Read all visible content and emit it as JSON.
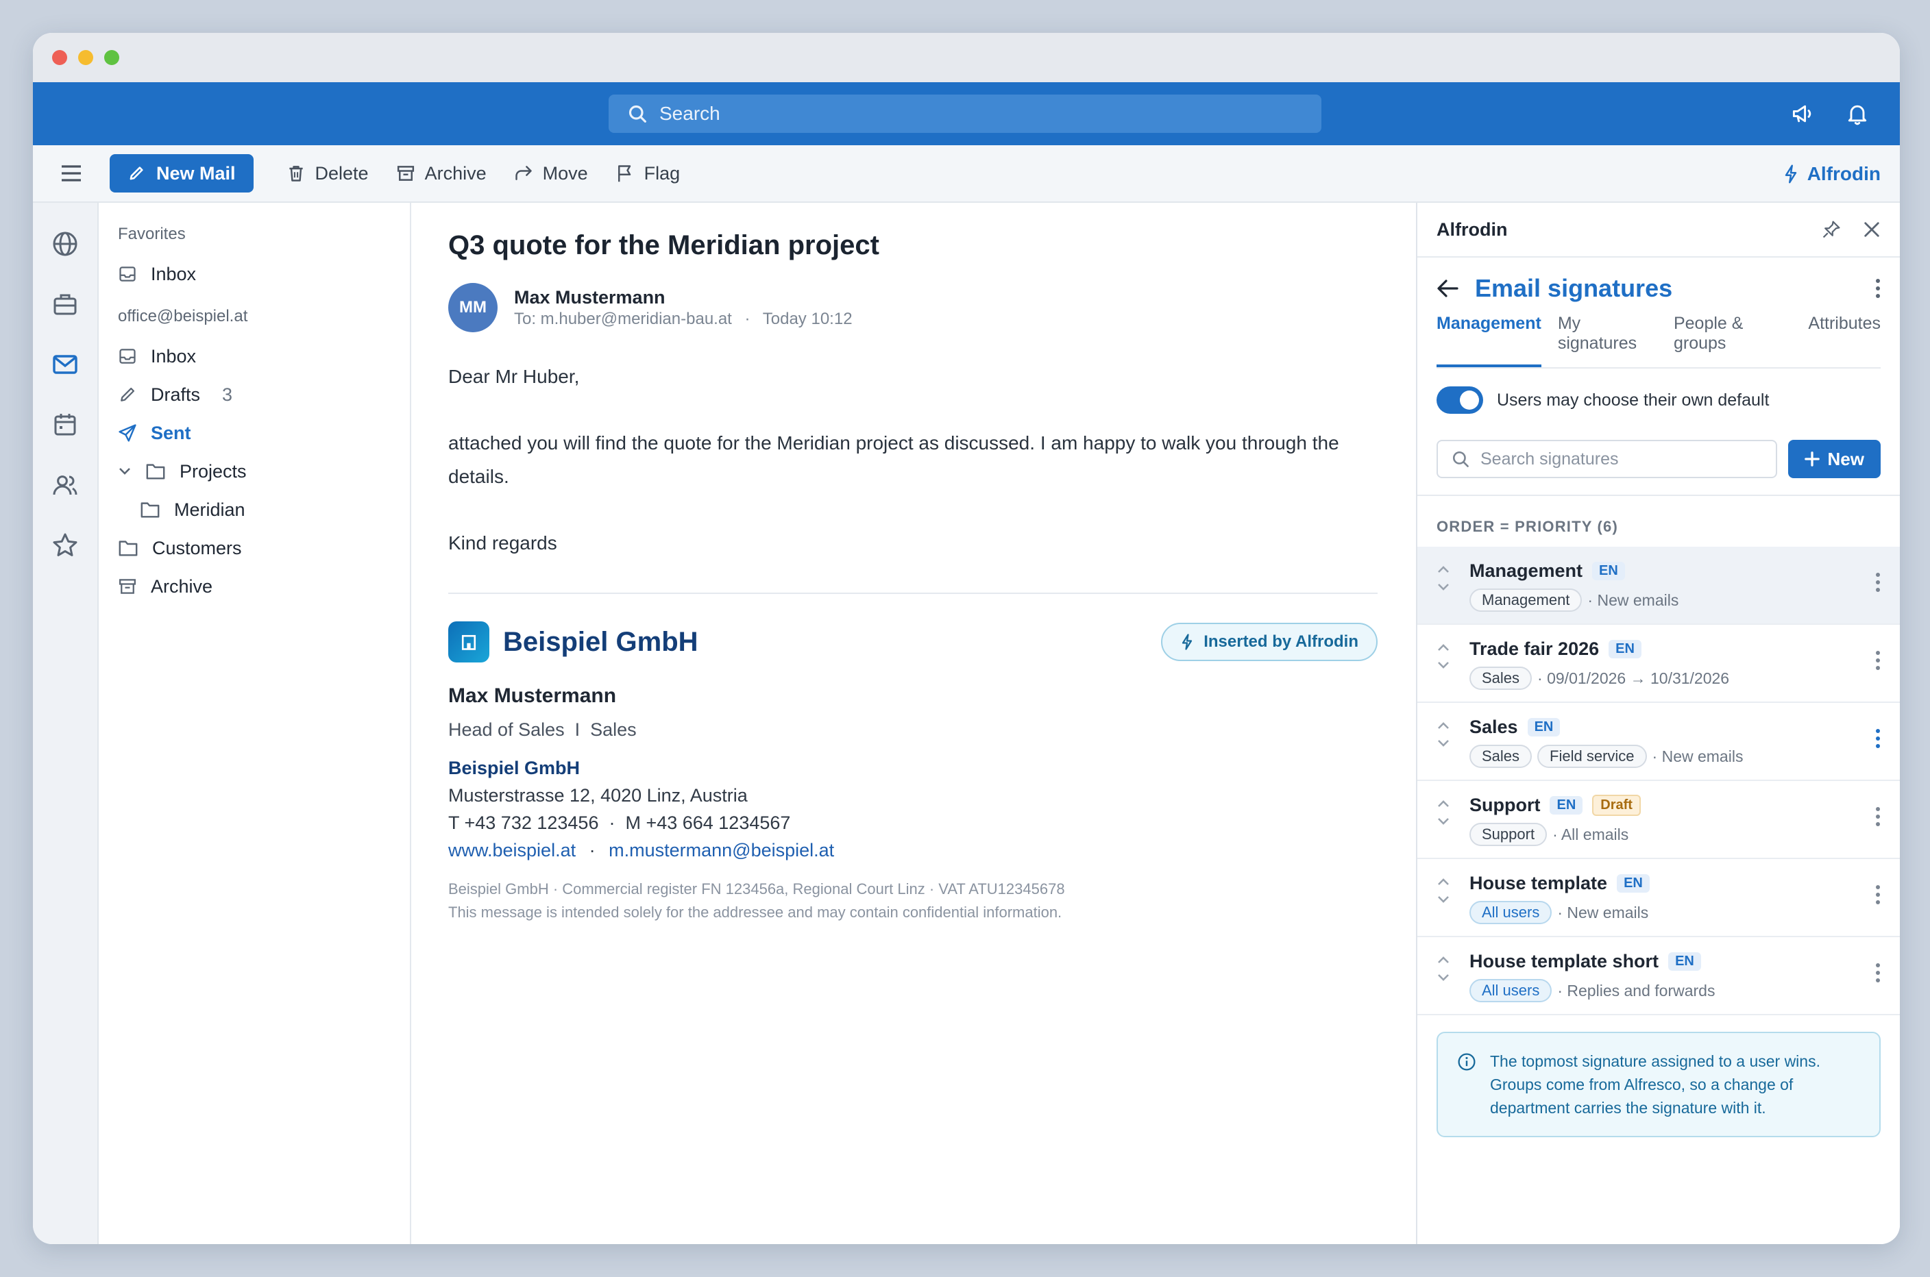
{
  "window": {
    "dots": [
      "#ee5f55",
      "#f6bc2f",
      "#5fc241"
    ]
  },
  "topbar": {
    "search_placeholder": "Search"
  },
  "toolbar": {
    "new_mail": "New Mail",
    "delete": "Delete",
    "archive": "Archive",
    "move": "Move",
    "flag": "Flag",
    "alfrodin": "Alfrodin"
  },
  "folders": {
    "favorites_label": "Favorites",
    "favorites_inbox": "Inbox",
    "account": "office@beispiel.at",
    "inbox": "Inbox",
    "drafts": "Drafts",
    "drafts_count": "3",
    "sent": "Sent",
    "projects": "Projects",
    "meridian": "Meridian",
    "customers": "Customers",
    "archive": "Archive"
  },
  "message": {
    "subject": "Q3 quote for the Meridian project",
    "avatar": "MM",
    "sender": "Max Mustermann",
    "to": "To: m.huber@meridian-bau.at",
    "sep": "·",
    "time": "Today 10:12",
    "greeting": "Dear Mr Huber,",
    "body": "attached you will find the quote for the Meridian project as discussed. I am happy to walk you through the details.",
    "closing": "Kind regards"
  },
  "signature": {
    "brand": "Beispiel GmbH",
    "inserted": "Inserted by Alfrodin",
    "name": "Max Mustermann",
    "role": "Head of Sales  I  Sales",
    "company": "Beispiel GmbH",
    "address": "Musterstrasse 12, 4020 Linz, Austria",
    "phones": "T +43 732 123456  ·  M +43 664 1234567",
    "website": "www.beispiel.at",
    "dot": "·",
    "email": "m.mustermann@beispiel.at",
    "legal1": "Beispiel GmbH · Commercial register FN 123456a, Regional Court Linz · VAT ATU12345678",
    "legal2": "This message is intended solely for the addressee and may contain confidential information."
  },
  "panel": {
    "app": "Alfrodin",
    "title": "Email signatures",
    "tabs": [
      "Management",
      "My signatures",
      "People & groups",
      "Attributes"
    ],
    "toggle_label": "Users may choose their own default",
    "search_placeholder": "Search signatures",
    "new_button": "New",
    "order_label": "ORDER = PRIORITY (6)",
    "info": "The topmost signature assigned to a user wins. Groups come from Alfresco, so a change of department carries the signature with it.",
    "rows": [
      {
        "name": "Management",
        "lang": "EN",
        "draft": "",
        "chips": [
          "Management"
        ],
        "chip_style": "",
        "meta": "· New emails"
      },
      {
        "name": "Trade fair 2026",
        "lang": "EN",
        "draft": "",
        "chips": [
          "Sales"
        ],
        "chip_style": "",
        "meta": "· 09/01/2026 → 10/31/2026"
      },
      {
        "name": "Sales",
        "lang": "EN",
        "draft": "",
        "chips": [
          "Sales",
          "Field service"
        ],
        "chip_style": "",
        "meta": "· New emails"
      },
      {
        "name": "Support",
        "lang": "EN",
        "draft": "Draft",
        "chips": [
          "Support"
        ],
        "chip_style": "",
        "meta": "· All emails"
      },
      {
        "name": "House template",
        "lang": "EN",
        "draft": "",
        "chips": [
          "All users"
        ],
        "chip_style": "blue",
        "meta": "· New emails"
      },
      {
        "name": "House template short",
        "lang": "EN",
        "draft": "",
        "chips": [
          "All users"
        ],
        "chip_style": "blue",
        "meta": "· Replies and forwards"
      }
    ]
  }
}
